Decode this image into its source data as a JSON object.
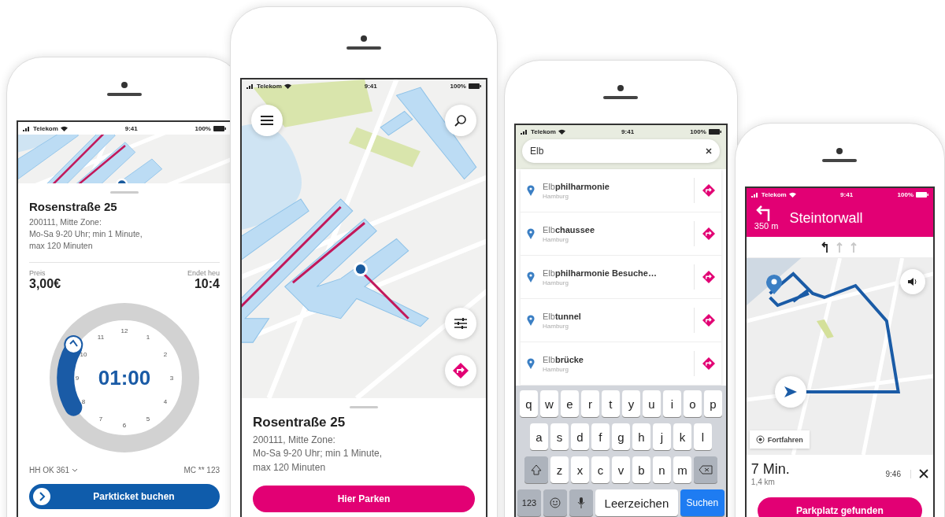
{
  "phones": [
    {
      "kind": "parking-ticket",
      "status": {
        "carrier": "Telekom",
        "time": "9:41",
        "battery": "100%"
      },
      "title": "Rosenstraße 25",
      "address": [
        "200111, Mitte Zone:",
        "Mo-Sa 9-20 Uhr; min 1 Minute,",
        "max 120 Minuten"
      ],
      "price_label": "Preis",
      "price": "3,00€",
      "end_label": "Endet heu",
      "end_time": "10:4",
      "clock_numbers": [
        "12",
        "1",
        "2",
        "3",
        "4",
        "5",
        "6",
        "7",
        "8",
        "9",
        "10",
        "11"
      ],
      "duration": "01:00",
      "plate": "HH OK 361",
      "plate_2": "MC ** 123",
      "button": "Parkticket buchen"
    },
    {
      "kind": "map",
      "status": {
        "carrier": "Telekom",
        "time": "9:41",
        "battery": "100%"
      },
      "title": "Rosentraße 25",
      "address": [
        "200111, Mitte Zone:",
        "Mo-Sa 9-20 Uhr; min 1 Minute,",
        "max 120 Minuten"
      ],
      "button": "Hier Parken"
    },
    {
      "kind": "search",
      "status": {
        "carrier": "Telekom",
        "time": "9:41",
        "battery": "100%"
      },
      "query": "Elb",
      "results": [
        {
          "name": "Elb**philharmonie**",
          "city": "Hamburg"
        },
        {
          "name": "Elb**chaussee**",
          "city": "Hamburg"
        },
        {
          "name": "Elb**philharmonie Besuche…**",
          "city": "Hamburg"
        },
        {
          "name": "Elb**tunnel**",
          "city": "Hamburg"
        },
        {
          "name": "Elb**brücke**",
          "city": "Hamburg"
        }
      ],
      "keyboard": {
        "rows": [
          [
            "q",
            "w",
            "e",
            "r",
            "t",
            "y",
            "u",
            "i",
            "o",
            "p"
          ],
          [
            "a",
            "s",
            "d",
            "f",
            "g",
            "h",
            "j",
            "k",
            "l"
          ],
          [
            "z",
            "x",
            "c",
            "v",
            "b",
            "n",
            "m"
          ]
        ],
        "numbers": "123",
        "space": "Leerzeichen",
        "search": "Suchen"
      }
    },
    {
      "kind": "navigation",
      "status": {
        "carrier": "Telekom",
        "time": "9:41",
        "battery": "100%"
      },
      "street": "Steintorwall",
      "distance": "350 m",
      "lanes": [
        {
          "selected": true
        },
        {
          "selected": false
        },
        {
          "selected": false
        }
      ],
      "continue": "Fortfahren",
      "duration": "7 Min.",
      "route_length": "1,4 km",
      "arrival": "9:46",
      "button": "Parkplatz gefunden"
    }
  ]
}
